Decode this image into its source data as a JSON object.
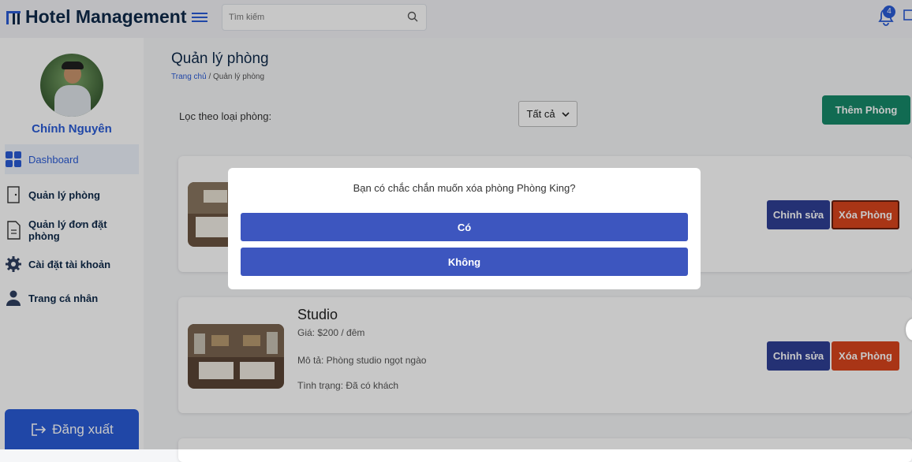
{
  "app": {
    "title": "Hotel Management"
  },
  "search": {
    "placeholder": "Tìm kiếm",
    "icon": "search-icon"
  },
  "notifications": {
    "count": "4"
  },
  "user": {
    "name": "Chính Nguyên"
  },
  "sidebar": {
    "items": [
      {
        "label": "Dashboard",
        "icon": "dashboard-grid-icon"
      },
      {
        "label": "Quản lý phòng",
        "icon": "door-icon"
      },
      {
        "label": "Quản lý đơn đặt phòng",
        "icon": "document-icon"
      },
      {
        "label": "Cài đặt tài khoản",
        "icon": "gear-icon"
      },
      {
        "label": "Trang cá nhân",
        "icon": "user-icon"
      }
    ],
    "logout_label": "Đăng xuất"
  },
  "main": {
    "title": "Quản lý phòng",
    "breadcrumb": {
      "home": "Trang chủ",
      "separator": "/",
      "current": "Quản lý phòng"
    },
    "filter_label": "Lọc theo loại phòng:",
    "filter_value": "Tất cả",
    "add_button": "Thêm Phòng"
  },
  "rooms": [
    {
      "name": "",
      "edit_label": "Chỉnh sửa",
      "delete_label": "Xóa Phòng"
    },
    {
      "name": "Studio",
      "price": "Giá: $200 / đêm",
      "description": "Mô tả: Phòng studio ngọt ngào",
      "status": "Tình trạng: Đã có khách",
      "edit_label": "Chỉnh sửa",
      "delete_label": "Xóa Phòng"
    }
  ],
  "modal": {
    "message": "Bạn có chắc chắn muốn xóa phòng Phòng King?",
    "confirm_label": "Có",
    "cancel_label": "Không"
  },
  "colors": {
    "primary": "#2a5bd7",
    "add_green": "#168a6a",
    "edit_navy": "#2f3f95",
    "delete_orange": "#d9441d",
    "modal_button": "#3d56bf"
  }
}
